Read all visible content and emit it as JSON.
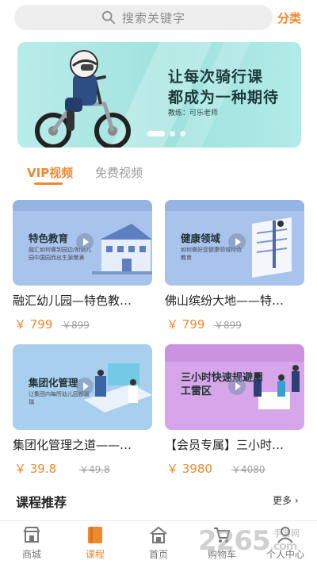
{
  "search": {
    "placeholder": "搜索关键字"
  },
  "header": {
    "category_label": "分类"
  },
  "banner": {
    "line1": "让每次骑行课",
    "line2": "都成为一种期待",
    "teacher": "教练：可乐老师"
  },
  "tabs": [
    {
      "label": "VIP视频",
      "active": true
    },
    {
      "label": "免费视频",
      "active": false
    }
  ],
  "courses": [
    {
      "thumb_title": "特色教育",
      "thumb_sub": "融汇如何做到园边/附幼儿园中国园而出生源爆满",
      "title": "融汇幼儿园—特色教…",
      "price": "￥ 799",
      "old_price": "￥899",
      "bg": "#a9c4ec"
    },
    {
      "thumb_title": "健康领域",
      "thumb_sub": "如何做好您健康领域特色教育",
      "title": "佛山缤纷大地——特…",
      "price": "￥ 799",
      "old_price": "￥899",
      "bg": "#a9c4ec"
    },
    {
      "thumb_title": "集团化管理",
      "thumb_sub": "让集团内每所幼儿园都赢瑞",
      "title": "集团化管理之道——…",
      "price": "￥ 39.8",
      "old_price": "￥49.8",
      "bg": "#a9cfee"
    },
    {
      "thumb_title": "三小时快速规避用工雷区",
      "thumb_sub": "",
      "title": "【会员专属】三小时…",
      "price": "￥ 3980",
      "old_price": "￥4080",
      "bg": "#d7a6ea"
    }
  ],
  "recommend": {
    "title": "课程推荐",
    "more": "更多"
  },
  "nav": [
    {
      "label": "商城",
      "icon": "shop-icon"
    },
    {
      "label": "课程",
      "icon": "book-icon",
      "active": true
    },
    {
      "label": "首页",
      "icon": "home-icon"
    },
    {
      "label": "购物车",
      "icon": "cart-icon"
    },
    {
      "label": "个人中心",
      "icon": "user-icon"
    }
  ],
  "watermark": {
    "brand": "2265",
    "suffix": ".com",
    "site": "手游网"
  },
  "colors": {
    "accent": "#f0882e",
    "banner": "#a3e3df"
  }
}
